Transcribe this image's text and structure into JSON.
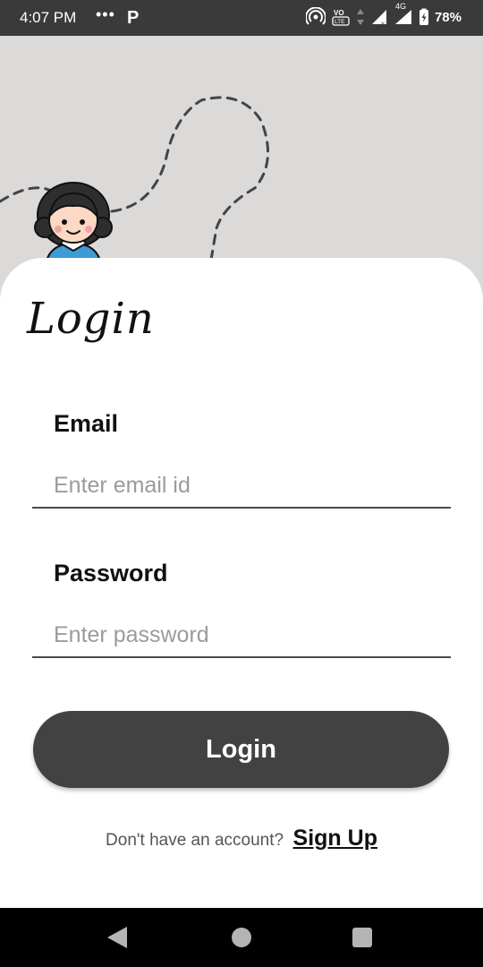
{
  "status_bar": {
    "time": "4:07 PM",
    "more_dots": "•••",
    "p_app": "P",
    "network": "4G",
    "battery": "78%",
    "icons": [
      "hotspot-icon",
      "volte-icon",
      "data-arrows-icon",
      "signal-icon",
      "signal-4g-icon",
      "battery-charging-icon"
    ]
  },
  "illustration": {
    "icon": "girl-avatar-icon",
    "path": "dashed-path"
  },
  "login": {
    "title": "Login",
    "email_label": "Email",
    "email_placeholder": "Enter email id",
    "password_label": "Password",
    "password_placeholder": "Enter password",
    "button_label": "Login",
    "signup_prompt": "Don't have an account?",
    "signup_link": "Sign Up"
  },
  "nav_bar": {
    "icons": [
      "back-icon",
      "home-icon",
      "recents-icon"
    ]
  },
  "colors": {
    "status_bar": "#3a3a3a",
    "background": "#dcdad9",
    "card": "#ffffff",
    "button": "#424242",
    "avatar_shirt": "#3d9bd6"
  }
}
